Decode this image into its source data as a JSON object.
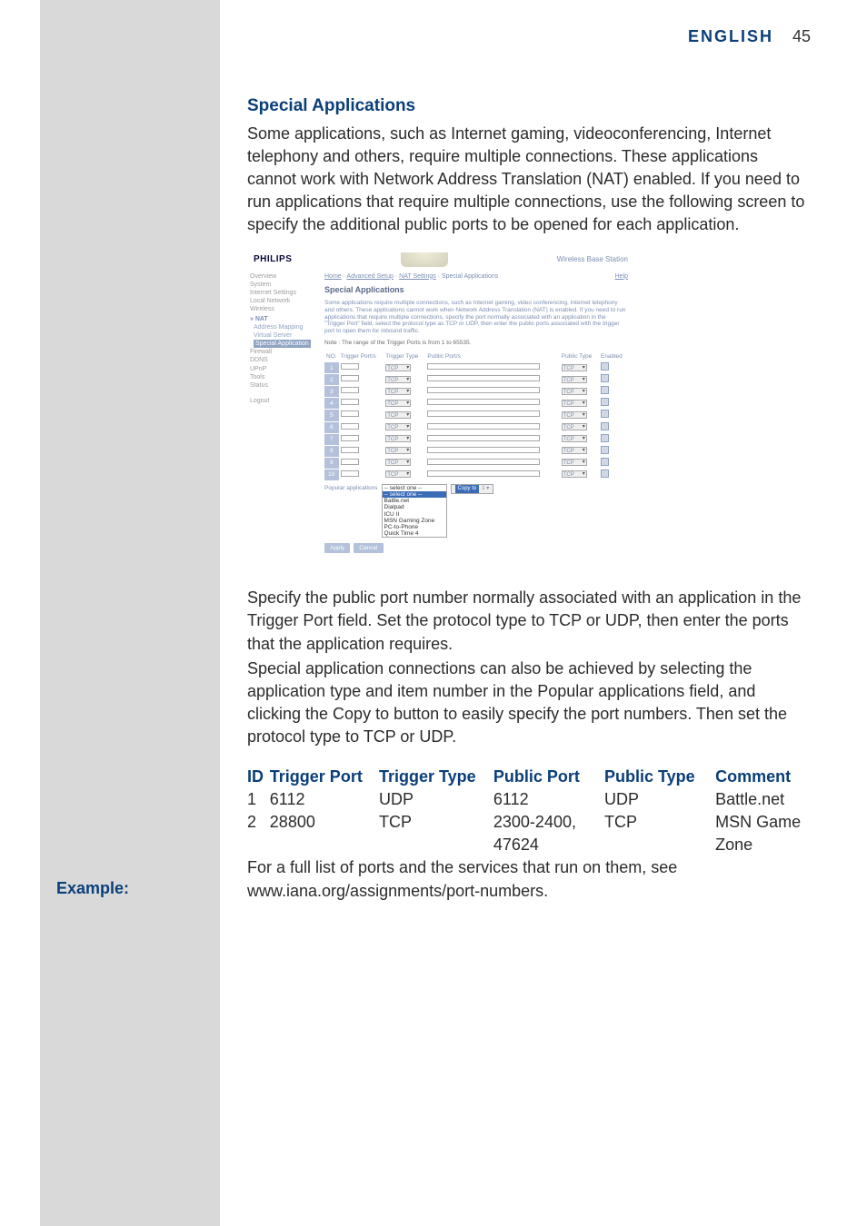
{
  "header": {
    "language": "ENGLISH",
    "page_number": "45"
  },
  "section": {
    "heading": "Special Applications",
    "intro": "Some applications, such as Internet gaming, videoconferencing, Internet telephony and others, require multiple connections. These applications cannot work with Network Address Translation (NAT) enabled. If you need to run applications that require multiple connections, use the following screen to specify the additional public ports to be opened for each application.",
    "after_shot_1": "Specify the public port number normally associated with an application in the Trigger Port field. Set the protocol type to TCP or UDP, then enter the ports that the application requires.",
    "after_shot_2": "Special application connections can also be achieved by selecting the application type and item number in the Popular applications field, and clicking the Copy to button to easily specify the port numbers. Then set the protocol type to TCP or UDP.",
    "closing": "For a full list of ports and the services that run on them, see www.iana.org/assignments/port-numbers."
  },
  "example_label": "Example:",
  "table": {
    "head": {
      "id": "ID",
      "trigger_port": "Trigger Port",
      "trigger_type": "Trigger Type",
      "public_port": "Public Port",
      "public_type": "Public Type",
      "comment": "Comment"
    },
    "rows": [
      {
        "id": "1",
        "trigger_port": "6112",
        "trigger_type": "UDP",
        "public_port": "6112",
        "public_type": "UDP",
        "comment": "Battle.net"
      },
      {
        "id": "2",
        "trigger_port": "28800",
        "trigger_type": "TCP",
        "public_port": "2300-2400, 47624",
        "public_type": "TCP",
        "comment": "MSN Game Zone"
      }
    ]
  },
  "shot": {
    "brand": "PHILIPS",
    "product": "Wireless Base Station",
    "help_link": "Help",
    "nav": {
      "items": [
        "Overview",
        "System",
        "Internet Settings",
        "Local Network",
        "Wireless"
      ],
      "nat_label": "» NAT",
      "nat_items": [
        "Address Mapping",
        "Virtual Server"
      ],
      "nat_active": "Special Application",
      "after": [
        "Firewall",
        "DDNS",
        "UPnP",
        "Tools",
        "Status",
        "Logout"
      ]
    },
    "crumb": {
      "p1": "Home",
      "p2": "Advanced Setup",
      "p3": "NAT Settings",
      "p4": "Special Applications"
    },
    "title": "Special Applications",
    "desc": "Some applications require multiple connections, such as Internet gaming, video conferencing, Internet telephony and others. These applications cannot work when Network Address Translation (NAT) is enabled. If you need to run applications that require multiple connections, specify the port normally associated with an application in the \"Trigger Port\" field, select the protocol type as TCP or UDP, then enter the public ports associated with the trigger port to open them for inbound traffic.",
    "note": "Note : The range of the Trigger Ports is from 1 to 65535.",
    "cols": {
      "no": "NO.",
      "tp": "Trigger Port/s",
      "tt": "Trigger Type",
      "pp": "Public Port/s",
      "pt": "Public Type",
      "en": "Enabled"
    },
    "sel_val": "TCP",
    "row_ids": [
      "1",
      "2",
      "3",
      "4",
      "5",
      "6",
      "7",
      "8",
      "9",
      "10"
    ],
    "popular_label": "Popular applications",
    "popular_sel": "-- select one --",
    "popular_opts": [
      "Battle.net",
      "Dialpad",
      "ICU II",
      "MSN Gaming Zone",
      "PC-to-Phone",
      "Quick Time 4"
    ],
    "copy_label": "Copy to",
    "apply": "Apply",
    "cancel": "Cancel"
  }
}
